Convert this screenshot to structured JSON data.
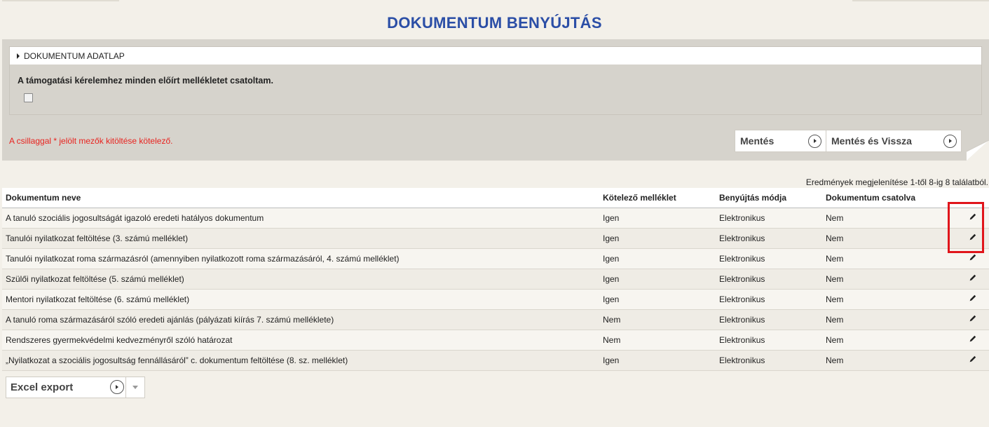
{
  "page": {
    "title": "DOKUMENTUM BENYÚJTÁS"
  },
  "adatlap": {
    "header_label": "DOKUMENTUM ADATLAP",
    "question": "A támogatási kérelemhez minden előírt mellékletet csatoltam.",
    "checkbox_checked": false
  },
  "required_note": "A csillaggal * jelölt mezők kitöltése kötelező.",
  "actions": {
    "save_label": "Mentés",
    "save_back_label": "Mentés és Vissza"
  },
  "results_info": "Eredmények megjelenítése 1-től 8-ig 8 találatból.",
  "table": {
    "columns": [
      "Dokumentum neve",
      "Kötelező melléklet",
      "Benyújtás módja",
      "Dokumentum csatolva",
      ""
    ],
    "rows": [
      [
        "A tanuló szociális jogosultságát igazoló eredeti hatályos dokumentum",
        "Igen",
        "Elektronikus",
        "Nem"
      ],
      [
        "Tanulói nyilatkozat feltöltése (3. számú melléklet)",
        "Igen",
        "Elektronikus",
        "Nem"
      ],
      [
        "Tanulói nyilatkozat roma származásról (amennyiben nyilatkozott roma származásáról, 4. számú melléklet)",
        "Igen",
        "Elektronikus",
        "Nem"
      ],
      [
        "Szülői nyilatkozat feltöltése (5. számú melléklet)",
        "Igen",
        "Elektronikus",
        "Nem"
      ],
      [
        "Mentori nyilatkozat feltöltése (6. számú melléklet)",
        "Igen",
        "Elektronikus",
        "Nem"
      ],
      [
        "A tanuló roma származásáról szóló eredeti ajánlás (pályázati kiírás 7. számú melléklete)",
        "Nem",
        "Elektronikus",
        "Nem"
      ],
      [
        "Rendszeres gyermekvédelmi kedvezményről szóló határozat",
        "Nem",
        "Elektronikus",
        "Nem"
      ],
      [
        "„Nyilatkozat a szociális jogosultság fennállásáról” c. dokumentum feltöltése (8. sz. melléklet)",
        "Igen",
        "Elektronikus",
        "Nem"
      ]
    ],
    "row_action_icon": "pencil-icon"
  },
  "export": {
    "label": "Excel export"
  },
  "colors": {
    "title": "#2b4ea6",
    "required_note": "#e8231f",
    "highlight": "#e0151b",
    "panel": "#d6d3cc",
    "page_bg": "#f3f0e9"
  }
}
